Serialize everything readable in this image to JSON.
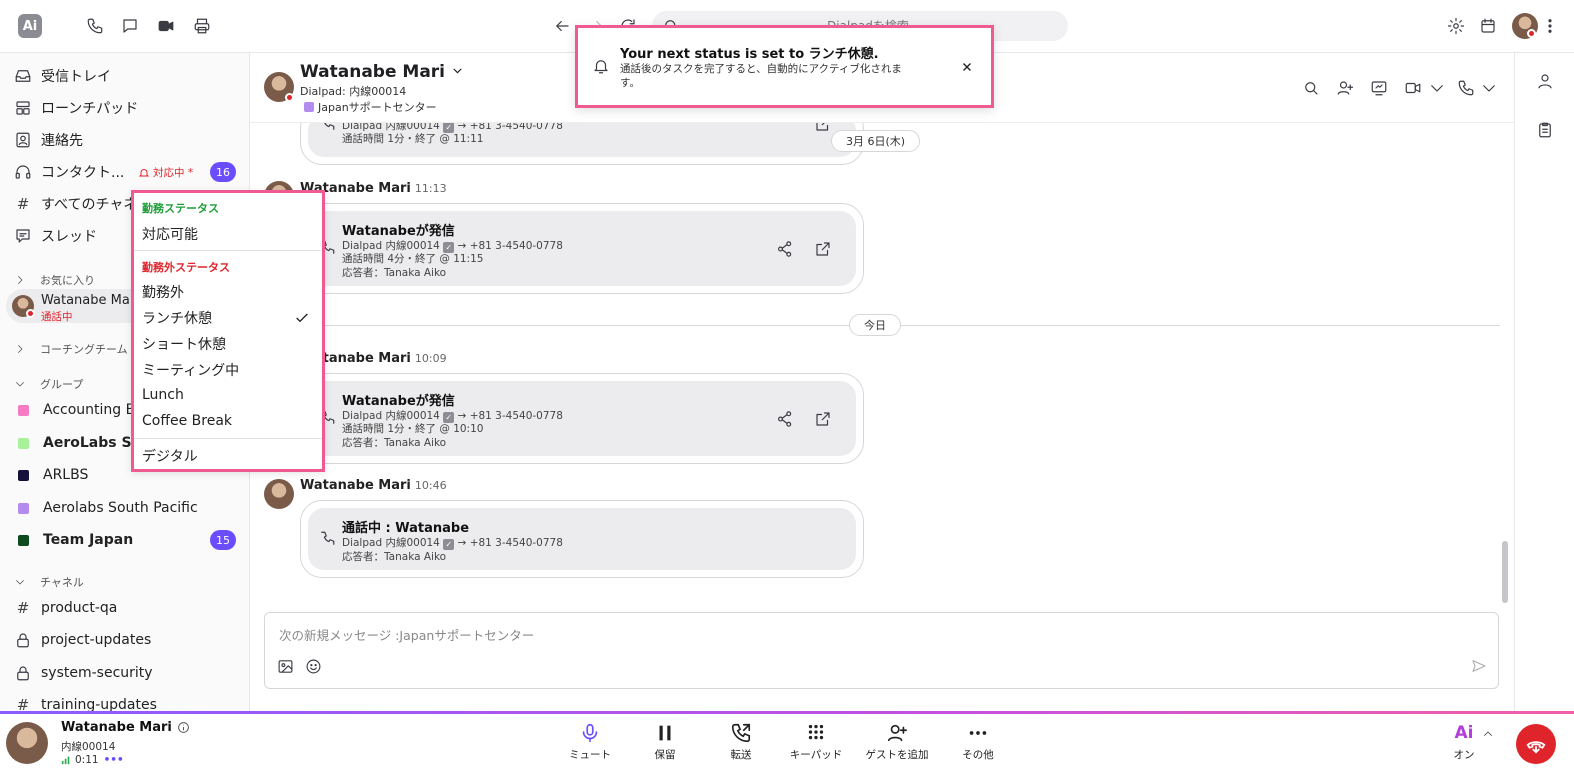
{
  "search": {
    "placeholder": "Dialpadを検索"
  },
  "sidebar": {
    "nav": [
      {
        "label": "受信トレイ",
        "icon": "inbox-icon"
      },
      {
        "label": "ローンチパッド",
        "icon": "launchpad-icon"
      },
      {
        "label": "連絡先",
        "icon": "contacts-icon"
      },
      {
        "label": "コンタクト...",
        "icon": "headset-icon"
      },
      {
        "label": "すべてのチャネ",
        "icon": "hash-icon"
      },
      {
        "label": "スレッド",
        "icon": "thread-icon"
      }
    ],
    "contact_center_status": "対応中 *",
    "contact_center_badge": "16",
    "favorites_label": "お気に入り",
    "favorite_user": {
      "name": "Watanabe Mar",
      "status": "通話中"
    },
    "coaching_label": "コーチングチーム",
    "groups_label": "グループ",
    "groups": [
      {
        "name": "Accounting Ea",
        "color": "#f57bc3",
        "bold": false
      },
      {
        "name": "AeroLabs San",
        "color": "#a9f29a",
        "bold": true
      },
      {
        "name": "ARLBS",
        "color": "#15113b",
        "bold": false
      },
      {
        "name": "Aerolabs South Pacific",
        "color": "#b48cf0",
        "bold": false
      },
      {
        "name": "Team Japan",
        "color": "#0d4a1d",
        "bold": true,
        "badge": "15"
      }
    ],
    "channels_label": "チャネル",
    "channels": [
      {
        "name": "product-qa",
        "icon": "hash"
      },
      {
        "name": "project-updates",
        "icon": "lock"
      },
      {
        "name": "system-security",
        "icon": "lock"
      },
      {
        "name": "training-updates",
        "icon": "hash"
      }
    ]
  },
  "status_menu": {
    "on_duty_header": "勤務ステータス",
    "on_duty_options": [
      "対応可能"
    ],
    "off_duty_header": "勤務外ステータス",
    "off_duty_options": [
      "勤務外",
      "ランチ休憩",
      "ショート休憩",
      "ミーティング中",
      "Lunch",
      "Coffee Break"
    ],
    "selected": "ランチ休憩",
    "extra_option": "デジタル",
    "colors": {
      "on_duty": "#1f9d3a",
      "off_duty": "#e0242b"
    }
  },
  "toast": {
    "title": "Your next status is set to ランチ休憩.",
    "body": "通話後のタスクを完了すると、自動的にアクティブ化されます。"
  },
  "conversation": {
    "name": "Watanabe Mari",
    "line": "Dialpad: 内線00014",
    "team": "Japanサポートセンター",
    "team_color": "#b48cf0"
  },
  "messages": {
    "first_card": {
      "line1_from": "Dialpad 内線00014",
      "line1_to": "+81 3-4540-0778",
      "line2": "通話時間 1分・終了 @ 11:11"
    },
    "date_label_1": "3月 6日(木)",
    "call1": {
      "author": "Watanabe Mari",
      "time": "11:13",
      "title": "Watanabeが発信",
      "from": "Dialpad 内線00014",
      "to": "+81 3-4540-0778",
      "duration": "通話時間 4分・終了 @ 11:15",
      "answerer": "応答者：Tanaka Aiko"
    },
    "date_label_2": "今日",
    "call2": {
      "author": "Watanabe Mari",
      "time": "10:09",
      "title": "Watanabeが発信",
      "from": "Dialpad 内線00014",
      "to": "+81 3-4540-0778",
      "duration": "通話時間 1分・終了 @ 10:10",
      "answerer": "応答者：Tanaka Aiko"
    },
    "call3": {
      "author": "Watanabe Mari",
      "time": "10:46",
      "title": "通話中 : Watanabe",
      "from": "Dialpad 内線00014",
      "to": "+81 3-4540-0778",
      "answerer": "応答者：Tanaka Aiko"
    }
  },
  "composer": {
    "placeholder": "次の新規メッセージ :Japanサポートセンター"
  },
  "callbar": {
    "name": "Watanabe Mari",
    "ext": "内線00014",
    "timer": "0:11",
    "controls": [
      {
        "label": "ミュート",
        "icon": "mic-icon"
      },
      {
        "label": "保留",
        "icon": "pause-icon"
      },
      {
        "label": "転送",
        "icon": "transfer-icon"
      },
      {
        "label": "キーパッド",
        "icon": "keypad-icon"
      },
      {
        "label": "ゲストを追加",
        "icon": "add-guest-icon"
      },
      {
        "label": "その他",
        "icon": "more-icon"
      }
    ],
    "ai_label": "オン"
  },
  "colors": {
    "accent": "#6c4cff",
    "highlight": "#ef5a93",
    "danger": "#e0242b"
  }
}
